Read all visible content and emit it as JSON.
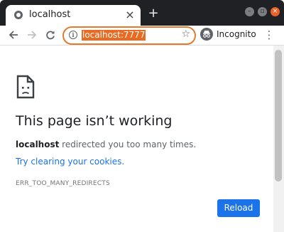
{
  "tab": {
    "title": "localhost"
  },
  "toolbar": {
    "url": "localhost:7777",
    "incognito_label": "Incognito"
  },
  "error": {
    "title": "This page isn’t working",
    "host": "localhost",
    "message": " redirected you too many times.",
    "suggestion": "Try clearing your cookies",
    "suggestion_suffix": ".",
    "code": "ERR_TOO_MANY_REDIRECTS",
    "button": "Reload"
  },
  "icons": {
    "favicon": "globe-icon",
    "tab_close": "close-icon",
    "new_tab": "plus-icon",
    "back": "arrow-left-icon",
    "forward": "arrow-right-icon",
    "reload": "reload-icon",
    "info": "info-icon",
    "bookmark": "star-icon",
    "incognito": "incognito-icon",
    "menu": "kebab-menu-icon",
    "error": "broken-document-icon"
  },
  "colors": {
    "titlebar": "#202124",
    "accent": "#1a73e8",
    "omnibox_focus": "#e37b2e",
    "url_selection": "#e96a21",
    "window_close": "#e8622a"
  }
}
